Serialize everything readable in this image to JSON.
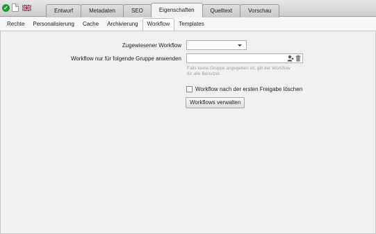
{
  "topbar": {
    "status_icon": "check-circle-icon",
    "page_icon": "blank-page-icon",
    "language_icon": "uk-flag-icon"
  },
  "main_tabs": [
    {
      "label": "Entwurf",
      "active": false
    },
    {
      "label": "Metadaten",
      "active": false
    },
    {
      "label": "SEO",
      "active": false
    },
    {
      "label": "Eigenschaften",
      "active": true
    },
    {
      "label": "Quelltext",
      "active": false
    },
    {
      "label": "Vorschau",
      "active": false
    }
  ],
  "sub_tabs": [
    {
      "label": "Rechte",
      "active": false
    },
    {
      "label": "Personalisierung",
      "active": false
    },
    {
      "label": "Cache",
      "active": false
    },
    {
      "label": "Archivierung",
      "active": false
    },
    {
      "label": "Workflow",
      "active": true
    },
    {
      "label": "Templates",
      "active": false
    }
  ],
  "form": {
    "assigned_workflow_label": "Zugewiesener Workflow",
    "assigned_workflow_value": "",
    "group_label": "Workflow nur für folgende Gruppe anwenden",
    "group_value": "",
    "group_hint": "Falls keine Gruppe angegeben ist, gilt der Workflow für alle Benutzer.",
    "delete_after_release_label": "Workflow nach der ersten Freigabe löschen",
    "delete_after_release_checked": false,
    "manage_button_label": "Workflows verwalten"
  }
}
